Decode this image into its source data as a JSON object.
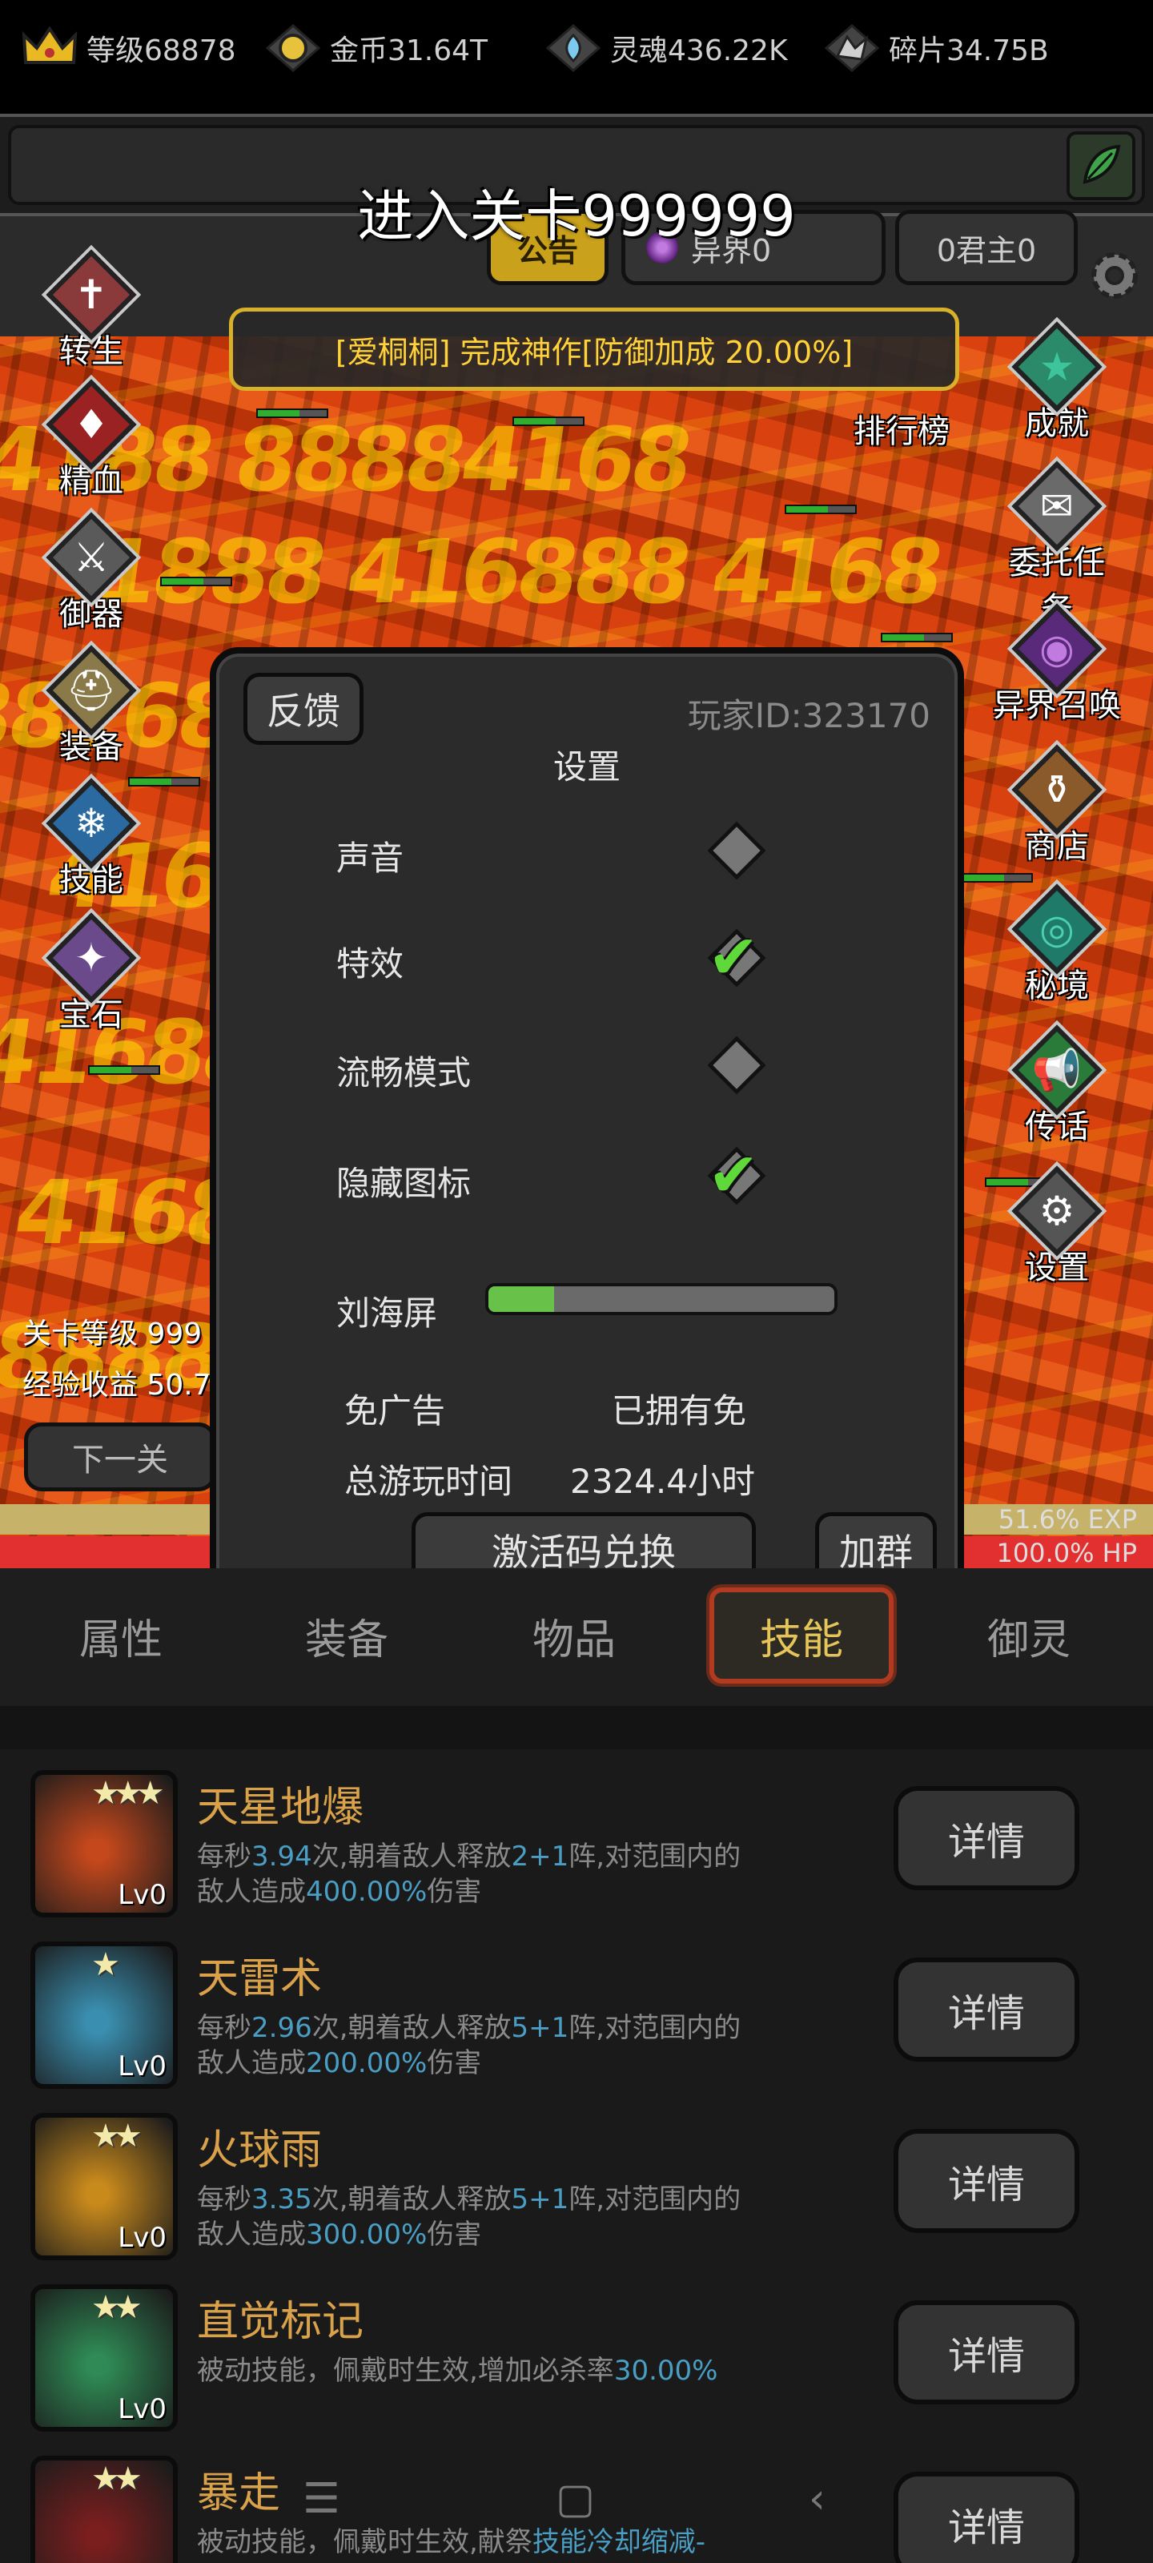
{
  "resources": [
    {
      "icon": "crown-icon",
      "label": "等级68878"
    },
    {
      "icon": "gold-coin-icon",
      "label": "金币31.64T"
    },
    {
      "icon": "soul-icon",
      "label": "灵魂436.22K"
    },
    {
      "icon": "shard-icon",
      "label": "碎片34.75B"
    }
  ],
  "stage_title": "进入关卡999999",
  "top_tabs": {
    "notice": "公告",
    "rift": "异界0",
    "lord": "0君主0"
  },
  "announcement": "[爱桐桐] 完成神作[防御加成 20.00%]",
  "left_menu": [
    "转生",
    "精血",
    "御器",
    "装备",
    "技能",
    "宝石"
  ],
  "right_menu": [
    "排行榜",
    "成就",
    "委托任务",
    "异界召唤",
    "商店",
    "秘境",
    "传话",
    "设置"
  ],
  "stage_info": {
    "level": "关卡等级 999",
    "exp": "经验收益 50.7"
  },
  "next_button": "下一关",
  "exp_text": "51.6% EXP",
  "hp_text": "100.0%  HP",
  "settings": {
    "feedback": "反馈",
    "player_id": "玩家ID:323170",
    "title": "设置",
    "rows": [
      {
        "label": "声音",
        "checked": false
      },
      {
        "label": "特效",
        "checked": true
      },
      {
        "label": "流畅模式",
        "checked": false
      },
      {
        "label": "隐藏图标",
        "checked": true
      }
    ],
    "notch_label": "刘海屏",
    "notch_fraction": 0.19,
    "no_ads_label": "免广告",
    "no_ads_value": "已拥有免",
    "playtime_label": "总游玩时间",
    "playtime_value": "2324.4小时",
    "code_button": "激活码兑换",
    "group_button": "加群"
  },
  "bottom_tabs": [
    "属性",
    "装备",
    "物品",
    "技能",
    "御灵"
  ],
  "active_tab": "技能",
  "skills": [
    {
      "name": "天星地爆",
      "stars": "★★★",
      "level": "Lv0",
      "icon_color": "#c4481c",
      "desc": [
        [
          "每秒",
          false
        ],
        [
          "3.94",
          true
        ],
        [
          "次,朝着敌人释放",
          false
        ],
        [
          "2+1",
          true
        ],
        [
          "阵,对范围内的敌人造成",
          false
        ],
        [
          "400.00%",
          true
        ],
        [
          "伤害",
          false
        ]
      ]
    },
    {
      "name": "天雷术",
      "stars": "★",
      "level": "Lv0",
      "icon_color": "#3a8fb0",
      "desc": [
        [
          "每秒",
          false
        ],
        [
          "2.96",
          true
        ],
        [
          "次,朝着敌人释放",
          false
        ],
        [
          "5+1",
          true
        ],
        [
          "阵,对范围内的敌人造成",
          false
        ],
        [
          "200.00%",
          true
        ],
        [
          "伤害",
          false
        ]
      ]
    },
    {
      "name": "火球雨",
      "stars": "★★",
      "level": "Lv0",
      "icon_color": "#c98a1c",
      "desc": [
        [
          "每秒",
          false
        ],
        [
          "3.35",
          true
        ],
        [
          "次,朝着敌人释放",
          false
        ],
        [
          "5+1",
          true
        ],
        [
          "阵,对范围内的敌人造成",
          false
        ],
        [
          "300.00%",
          true
        ],
        [
          "伤害",
          false
        ]
      ]
    },
    {
      "name": "直觉标记",
      "stars": "★★",
      "level": "Lv0",
      "icon_color": "#2f8a55",
      "desc": [
        [
          "被动技能，佩戴时生效,增加必杀率",
          false
        ],
        [
          "30.00%",
          true
        ]
      ]
    },
    {
      "name": "暴走",
      "stars": "★★",
      "level": "",
      "icon_color": "#7a1e1e",
      "desc": [
        [
          "被动技能，佩戴时生效,献祭",
          false
        ],
        [
          "技能冷却缩减-",
          true
        ]
      ]
    }
  ],
  "detail_button": "详情"
}
